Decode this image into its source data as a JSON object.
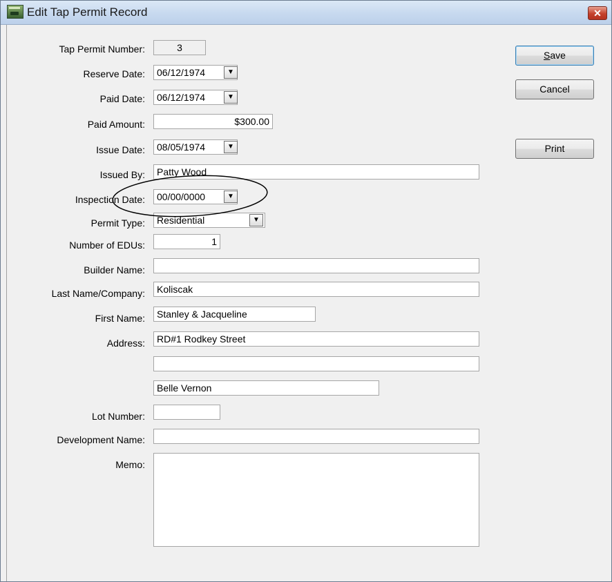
{
  "window": {
    "title": "Edit Tap Permit Record",
    "close_glyph": "✕"
  },
  "form": {
    "tap_permit_number": {
      "label": "Tap Permit Number:",
      "value": "3"
    },
    "reserve_date": {
      "label": "Reserve Date:",
      "value": "06/12/1974"
    },
    "paid_date": {
      "label": "Paid Date:",
      "value": "06/12/1974"
    },
    "paid_amount": {
      "label": "Paid Amount:",
      "value": "$300.00"
    },
    "issue_date": {
      "label": "Issue Date:",
      "value": "08/05/1974"
    },
    "issued_by": {
      "label": "Issued By:",
      "value": "Patty Wood"
    },
    "inspection_date": {
      "label": "Inspection Date:",
      "value": "00/00/0000"
    },
    "permit_type": {
      "label": "Permit Type:",
      "value": "Residential"
    },
    "number_of_edus": {
      "label": "Number of EDUs:",
      "value": "1"
    },
    "builder_name": {
      "label": "Builder Name:",
      "value": ""
    },
    "last_name": {
      "label": "Last Name/Company:",
      "value": "Koliscak"
    },
    "first_name": {
      "label": "First Name:",
      "value": "Stanley & Jacqueline"
    },
    "address": {
      "label": "Address:",
      "line1": "RD#1 Rodkey Street",
      "line2": "",
      "city": "Belle Vernon"
    },
    "lot_number": {
      "label": "Lot Number:",
      "value": ""
    },
    "development_name": {
      "label": "Development Name:",
      "value": ""
    },
    "memo": {
      "label": "Memo:",
      "value": ""
    }
  },
  "buttons": {
    "save": {
      "accel": "S",
      "rest": "ave"
    },
    "cancel": "Cancel",
    "print": "Print"
  },
  "dropdown_glyph": "▼",
  "icons": {
    "app": "app-icon",
    "close": "close-icon",
    "dropdown": "chevron-down-icon"
  },
  "colors": {
    "titlebar": "#c7d9ef",
    "close_button": "#c4412c",
    "default_button_border": "#3c7fb1"
  }
}
